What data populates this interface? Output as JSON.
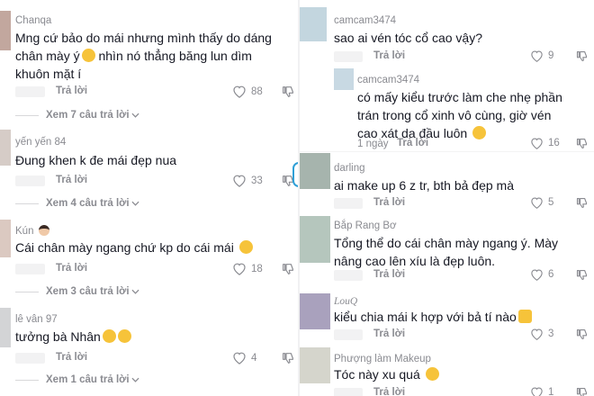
{
  "left": {
    "comments": [
      {
        "username": "Chanqa",
        "text": "Mng cứ bảo do mái nhưng mình thấy do dáng chân mày ý",
        "text_tail": " nhìn nó thẳng băng lun dìm khuôn mặt í",
        "emoji": "grinning-sweat-emoji",
        "reply_label": "Trả lời",
        "likes": "88",
        "view_more": "Xem 7 câu trả lời",
        "avatar_color": "#c2a79e"
      },
      {
        "username": "yến yến 84",
        "text": "Đung khen k đe mái đẹp nua",
        "reply_label": "Trả lời",
        "likes": "33",
        "view_more": "Xem 4 câu trả lời",
        "avatar_color": "#d6ccc7"
      },
      {
        "username": "Kún",
        "username_emoji": "girl-face-emoji",
        "text": "Cái chân mày ngang chứ kp do cái mái",
        "emoji": "laughing-tears-emoji",
        "reply_label": "Trả lời",
        "likes": "18",
        "view_more": "Xem 3 câu trả lời",
        "avatar_color": "#dbc9c1"
      },
      {
        "username": "lê vân 97",
        "text": "tưởng bà Nhân",
        "emoji": "rofl-emoji",
        "reply_label": "Trả lời",
        "likes": "4",
        "view_more": "Xem 1 câu trả lời",
        "avatar_color": "#d3d4d6"
      }
    ]
  },
  "right": {
    "comments": [
      {
        "username": "camcam3474",
        "text": "sao ai vén tóc cổ cao vậy?",
        "reply_label": "Trả lời",
        "likes": "9",
        "avatar_color": "#c3d6df"
      },
      {
        "username": "camcam3474",
        "text": "có mấy kiểu trước làm che nhẹ phần trán trong cổ xinh vô cùng, giờ vén cao xát da đầu luôn",
        "emoji": "pleading-emoji",
        "time": "1 ngày",
        "reply_label": "Trả lời",
        "likes": "16",
        "avatar_color": "#c8d9e3"
      },
      {
        "username": "darling",
        "text": "ai make up 6 z tr, bth bả đẹp mà",
        "reply_label": "Trả lời",
        "likes": "5",
        "avatar_color": "#a6b4ad"
      },
      {
        "username": "Bắp Rang Bơ",
        "text": "Tổng thể do cái chân mày ngang ý. Mày nâng cao lên xíu là đẹp luôn.",
        "reply_label": "Trả lời",
        "likes": "6",
        "avatar_color": "#b5c6bd"
      },
      {
        "username": "LouQ",
        "text": "kiểu chia mái k hợp với bả tí nào",
        "emoji": "folded-hands-emoji",
        "reply_label": "Trả lời",
        "likes": "3",
        "avatar_color": "#a9a1bd"
      },
      {
        "username": "Phượng làm Makeup",
        "text": "Tóc này xu quá",
        "emoji": "laughing-tears-emoji",
        "reply_label": "Trả lời",
        "likes": "1",
        "avatar_color": "#d5d5cc"
      }
    ]
  },
  "colors": {
    "text": "#161823",
    "muted": "#8a8b91",
    "emoji_yellow": "#f6c33a",
    "accent_ring": "#2f9fd6"
  }
}
